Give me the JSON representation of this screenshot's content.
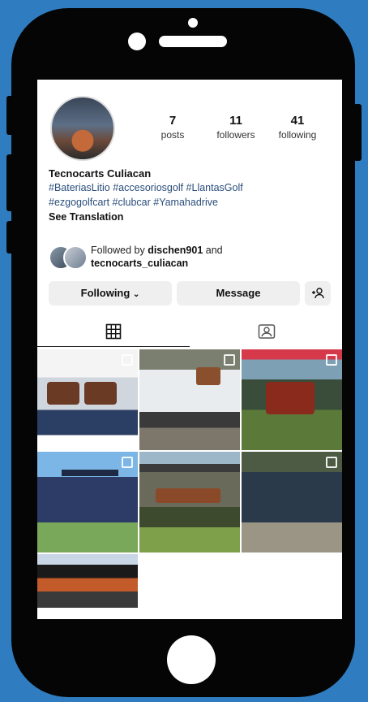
{
  "profile": {
    "username": "Tecnocarts Culiacan",
    "stats": [
      {
        "value": "7",
        "label": "posts"
      },
      {
        "value": "11",
        "label": "followers"
      },
      {
        "value": "41",
        "label": "following"
      }
    ],
    "bio_lines": [
      "#BateriasLitio #accesoriosgolf #LlantasGolf",
      "#ezgogolfcart #clubcar #Yamahadrive"
    ],
    "see_translation": "See Translation",
    "followed_by_prefix": "Followed by",
    "followed_by_user1": "dischen901",
    "followed_by_and": "and",
    "followed_by_user2": "tecnocarts_culiacan"
  },
  "actions": {
    "following_label": "Following",
    "message_label": "Message"
  },
  "tabs": [
    "grid-icon",
    "tagged-icon"
  ],
  "posts_count_visible": 7
}
